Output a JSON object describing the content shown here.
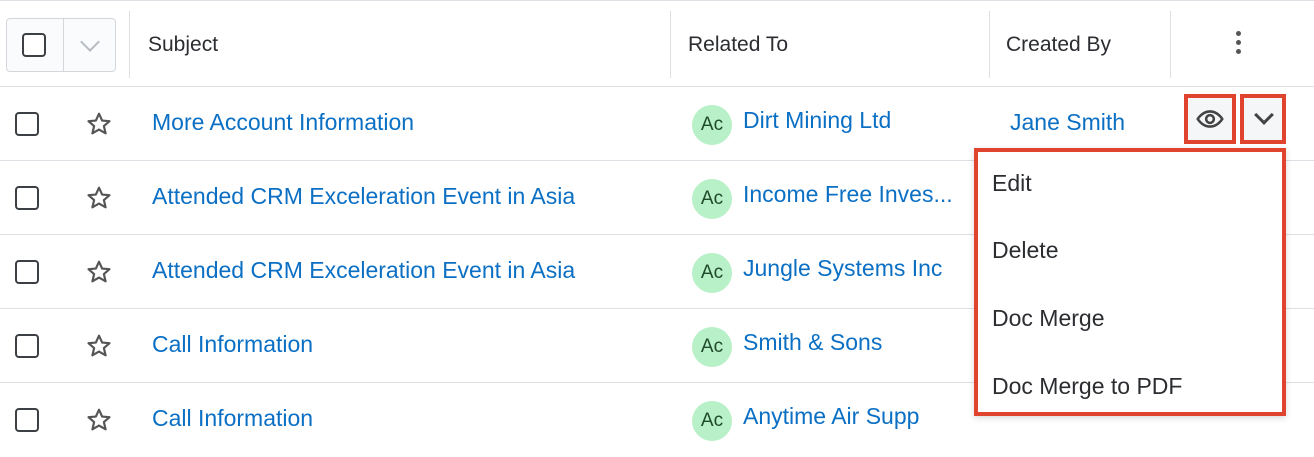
{
  "header": {
    "subject_label": "Subject",
    "related_to_label": "Related To",
    "created_by_label": "Created By"
  },
  "rows": [
    {
      "subject": "More Account Information",
      "badge": "Ac",
      "related_to": "Dirt Mining Ltd",
      "created_by": "Jane Smith"
    },
    {
      "subject": "Attended CRM Exceleration Event in Asia",
      "badge": "Ac",
      "related_to": "Income Free Inves...",
      "created_by": ""
    },
    {
      "subject": "Attended CRM Exceleration Event in Asia",
      "badge": "Ac",
      "related_to": "Jungle Systems Inc",
      "created_by": ""
    },
    {
      "subject": "Call Information",
      "badge": "Ac",
      "related_to": "Smith & Sons",
      "created_by": ""
    },
    {
      "subject": "Call Information",
      "badge": "Ac",
      "related_to": "Anytime Air Supp",
      "created_by": ""
    }
  ],
  "row_actions_menu": {
    "items": [
      "Edit",
      "Delete",
      "Doc Merge",
      "Doc Merge to PDF"
    ]
  },
  "icons": {
    "header_checkbox": "checkbox-icon",
    "header_dropdown": "chevron-down-icon",
    "header_more": "kebab-icon",
    "favorite": "star-icon",
    "preview": "eye-icon",
    "actions_dropdown": "chevron-down-icon"
  },
  "colors": {
    "link": "#0b6fc4",
    "badge_bg": "#b8f0c8",
    "highlight": "#e0442f"
  }
}
